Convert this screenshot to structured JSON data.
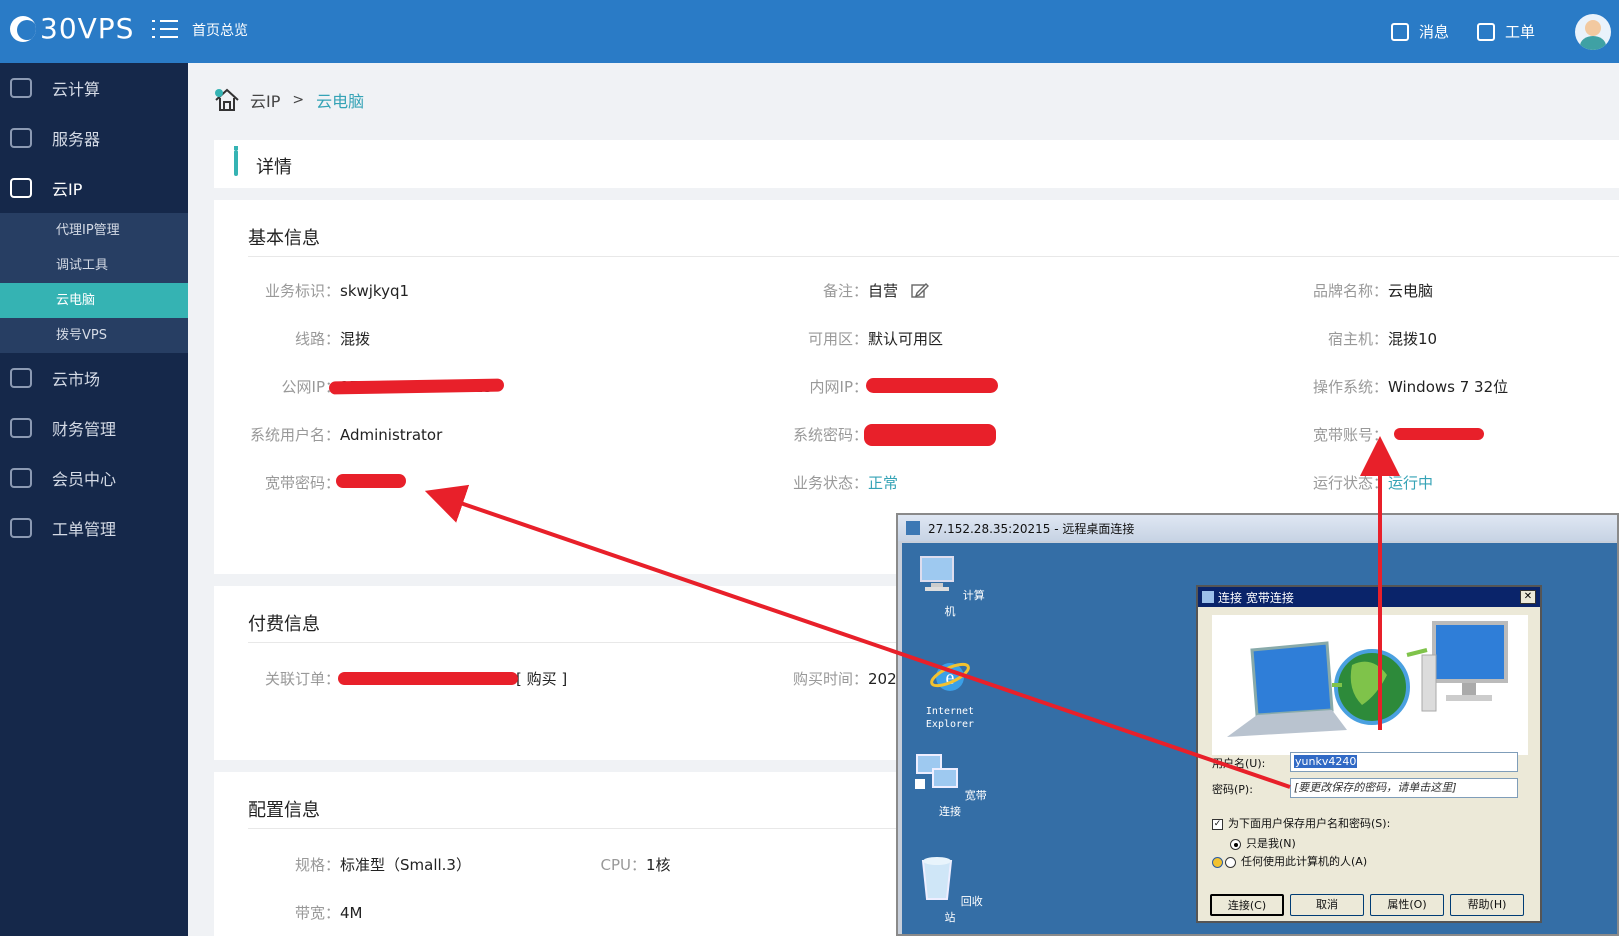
{
  "header": {
    "logo_text": "30VPS",
    "home_overview": "首页总览",
    "messages": "消息",
    "tickets": "工单"
  },
  "sidebar": {
    "items": [
      {
        "label": "云计算",
        "icon": "cloud-compute-icon"
      },
      {
        "label": "服务器",
        "icon": "server-icon"
      },
      {
        "label": "云IP",
        "icon": "monitor-icon"
      },
      {
        "label": "云市场",
        "icon": "market-icon"
      },
      {
        "label": "财务管理",
        "icon": "finance-icon"
      },
      {
        "label": "会员中心",
        "icon": "user-icon"
      },
      {
        "label": "工单管理",
        "icon": "clipboard-icon"
      }
    ],
    "sub_items": [
      "代理IP管理",
      "调试工具",
      "云电脑",
      "拨号VPS"
    ]
  },
  "breadcrumb": {
    "root": "云IP",
    "sep": ">",
    "current": "云电脑"
  },
  "detail_title": "详情",
  "basic": {
    "title": "基本信息",
    "service_id_label": "业务标识：",
    "service_id": "skwjkyq1",
    "remark_label": "备注：",
    "remark": "自营",
    "brand_label": "品牌名称：",
    "brand": "云电脑",
    "line_label": "线路：",
    "line": "混拨",
    "zone_label": "可用区：",
    "zone": "默认可用区",
    "host_label": "宿主机：",
    "host": "混拨10",
    "public_ip_label": "公网IP：",
    "public_ip": "27.152.28.35:20215",
    "private_ip_label": "内网IP：",
    "os_label": "操作系统：",
    "os": "Windows 7 32位",
    "sys_user_label": "系统用户名：",
    "sys_user": "Administrator",
    "sys_pwd_label": "系统密码：",
    "bb_account_label": "宽带账号：",
    "bb_pwd_label": "宽带密码：",
    "biz_status_label": "业务状态：",
    "biz_status": "正常",
    "run_status_label": "运行状态：",
    "run_status": "运行中"
  },
  "payment": {
    "title": "付费信息",
    "order_label": "关联订单：",
    "buy_link": "[ 购买 ]",
    "buy_time_label": "购买时间：",
    "buy_time": "202"
  },
  "config": {
    "title": "配置信息",
    "spec_label": "规格：",
    "spec": "标准型（Small.3）",
    "cpu_label": "CPU：",
    "cpu": "1核",
    "bw_label": "带宽：",
    "bw": "4M"
  },
  "rdp": {
    "title": "27.152.28.35:20215 - 远程桌面连接",
    "icons": [
      {
        "label": "计算机"
      },
      {
        "label": "Internet\nExplorer"
      },
      {
        "label": "宽带连接"
      },
      {
        "label": "回收站"
      }
    ],
    "dialog": {
      "title": "连接 宽带连接",
      "close": "✕",
      "username_label": "用户名(U):",
      "username": "yunkv4240",
      "password_label": "密码(P):",
      "password_placeholder": "[要更改保存的密码，请单击这里]",
      "save_label": "为下面用户保存用户名和密码(S):",
      "only_me": "只是我(N)",
      "anyone": "任何使用此计算机的人(A)",
      "btn_connect": "连接(C)",
      "btn_cancel": "取消",
      "btn_props": "属性(O)",
      "btn_help": "帮助(H)"
    }
  },
  "colors": {
    "primary": "#2a7bc6",
    "sidebar": "#15284a",
    "accent": "#35b3b3",
    "annotation": "#e8202a"
  }
}
